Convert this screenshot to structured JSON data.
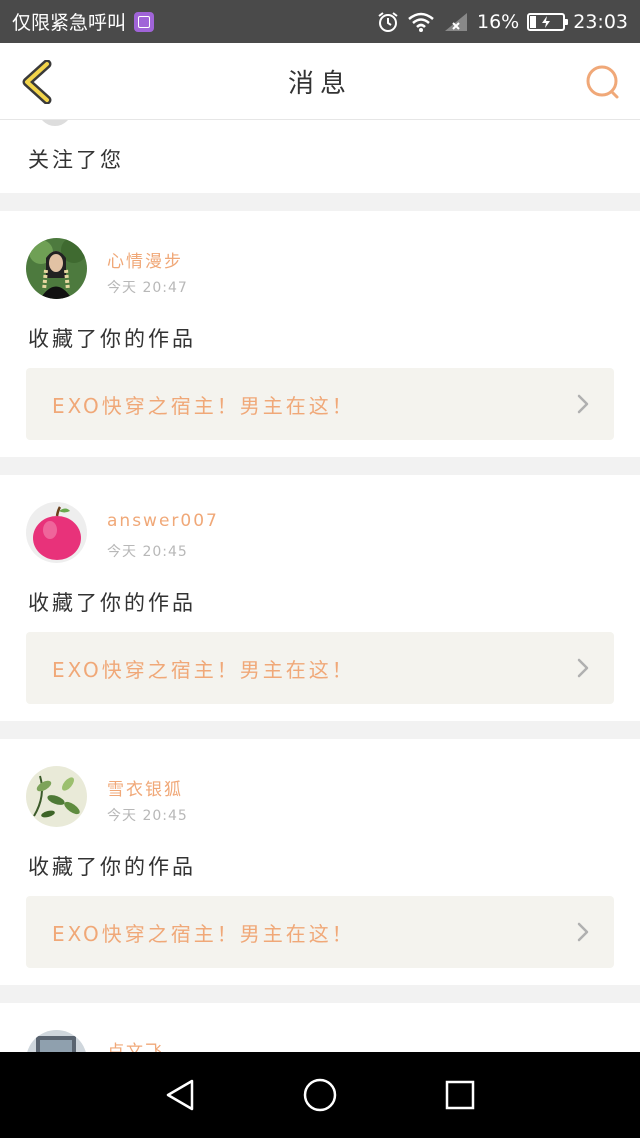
{
  "status_bar": {
    "carrier_text": "仅限紧急呼叫",
    "battery_percent": "16%",
    "time": "23:03"
  },
  "header": {
    "title": "消息"
  },
  "top_partial": {
    "action": "关注了您"
  },
  "messages": [
    {
      "username": "心情漫步",
      "time": "今天 20:47",
      "action": "收藏了你的作品",
      "work_title": "EXO快穿之宿主！男主在这！"
    },
    {
      "username": "answer007",
      "time": "今天 20:45",
      "action": "收藏了你的作品",
      "work_title": "EXO快穿之宿主！男主在这！"
    },
    {
      "username": "雪衣银狐",
      "time": "今天 20:45",
      "action": "收藏了你的作品",
      "work_title": "EXO快穿之宿主！男主在这！"
    }
  ],
  "bottom_partial": {
    "username": "卢文飞"
  },
  "colors": {
    "accent": "#f0a878",
    "header_back_icon": "#c8a020",
    "search_icon": "#f0a878"
  }
}
